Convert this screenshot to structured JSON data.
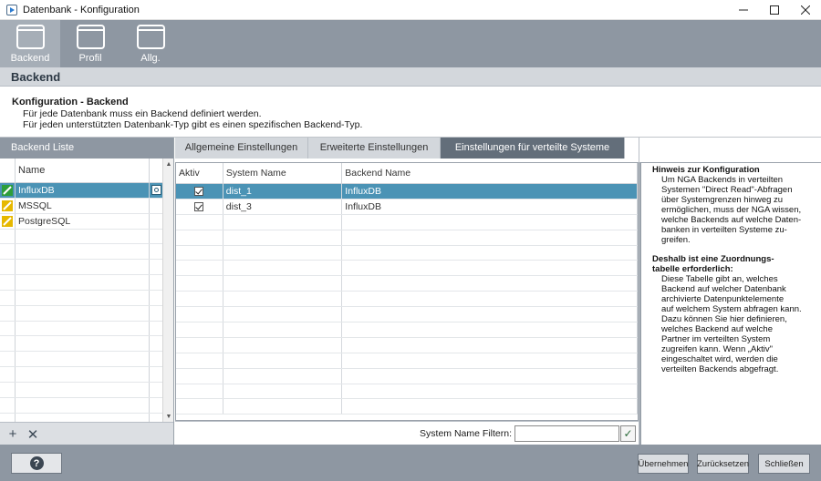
{
  "window": {
    "title": "Datenbank - Konfiguration",
    "controls": [
      "minimize-icon",
      "maximize-icon",
      "close-icon"
    ]
  },
  "toolbar": {
    "items": [
      {
        "label": "Backend",
        "active": true
      },
      {
        "label": "Profil",
        "active": false
      },
      {
        "label": "Allg.",
        "active": false
      }
    ]
  },
  "section": {
    "title": "Backend"
  },
  "description": {
    "heading": "Konfiguration - Backend",
    "line1": "Für jede Datenbank muss ein Backend definiert werden.",
    "line2": "Für jeden unterstützten Datenbank-Typ gibt es einen spezifischen Backend-Typ."
  },
  "backend_list": {
    "header": "Backend Liste",
    "column_name": "Name",
    "items": [
      {
        "name": "InfluxDB",
        "selected": true,
        "status": "green"
      },
      {
        "name": "MSSQL",
        "selected": false,
        "status": "yellow"
      },
      {
        "name": "PostgreSQL",
        "selected": false,
        "status": "yellow"
      }
    ],
    "add_label": "+",
    "remove_label": "✕"
  },
  "tabs": [
    {
      "label": "Allgemeine Einstellungen",
      "active": false
    },
    {
      "label": "Erweiterte Einstellungen",
      "active": false
    },
    {
      "label": "Einstellungen für verteilte Systeme",
      "active": true
    }
  ],
  "distributed_table": {
    "columns": [
      "Aktiv",
      "System Name",
      "Backend Name"
    ],
    "rows": [
      {
        "active": true,
        "system": "dist_1",
        "backend": "InfluxDB",
        "selected": true
      },
      {
        "active": true,
        "system": "dist_3",
        "backend": "InfluxDB",
        "selected": false
      }
    ],
    "filter_label": "System Name Filtern:",
    "filter_value": ""
  },
  "hint": {
    "title": "Hinweis zur Konfiguration",
    "body1": [
      "Um NGA Backends in verteilten",
      "Systemen \"Direct Read\"-Abfragen",
      "über Systemgrenzen hinweg zu",
      "ermöglichen, muss der NGA wissen,",
      "welche Backends auf welche Daten-",
      "banken in verteilten Systeme zu-",
      "greifen."
    ],
    "title2a": "Deshalb ist eine Zuordnungs-",
    "title2b": "tabelle erforderlich:",
    "body2": [
      "Diese Tabelle gibt an, welches",
      "Backend auf welcher Datenbank",
      "archivierte Datenpunktelemente",
      "auf welchem System abfragen kann.",
      "Dazu können Sie hier definieren,",
      "welches Backend auf welche",
      "Partner im verteilten System",
      "zugreifen kann. Wenn „Aktiv\"",
      "eingeschaltet wird, werden die",
      "verteilten Backends abgefragt."
    ]
  },
  "footer": {
    "help_label": "?",
    "apply_label": "Übernehmen",
    "reset_label": "Zurücksetzen",
    "close_label": "Schließen"
  },
  "colors": {
    "toolbar": "#8e97a2",
    "selection": "#4b93b5",
    "active_tab": "#636e7a",
    "status_green": "#2e9e3a",
    "status_yellow": "#e6b800"
  }
}
